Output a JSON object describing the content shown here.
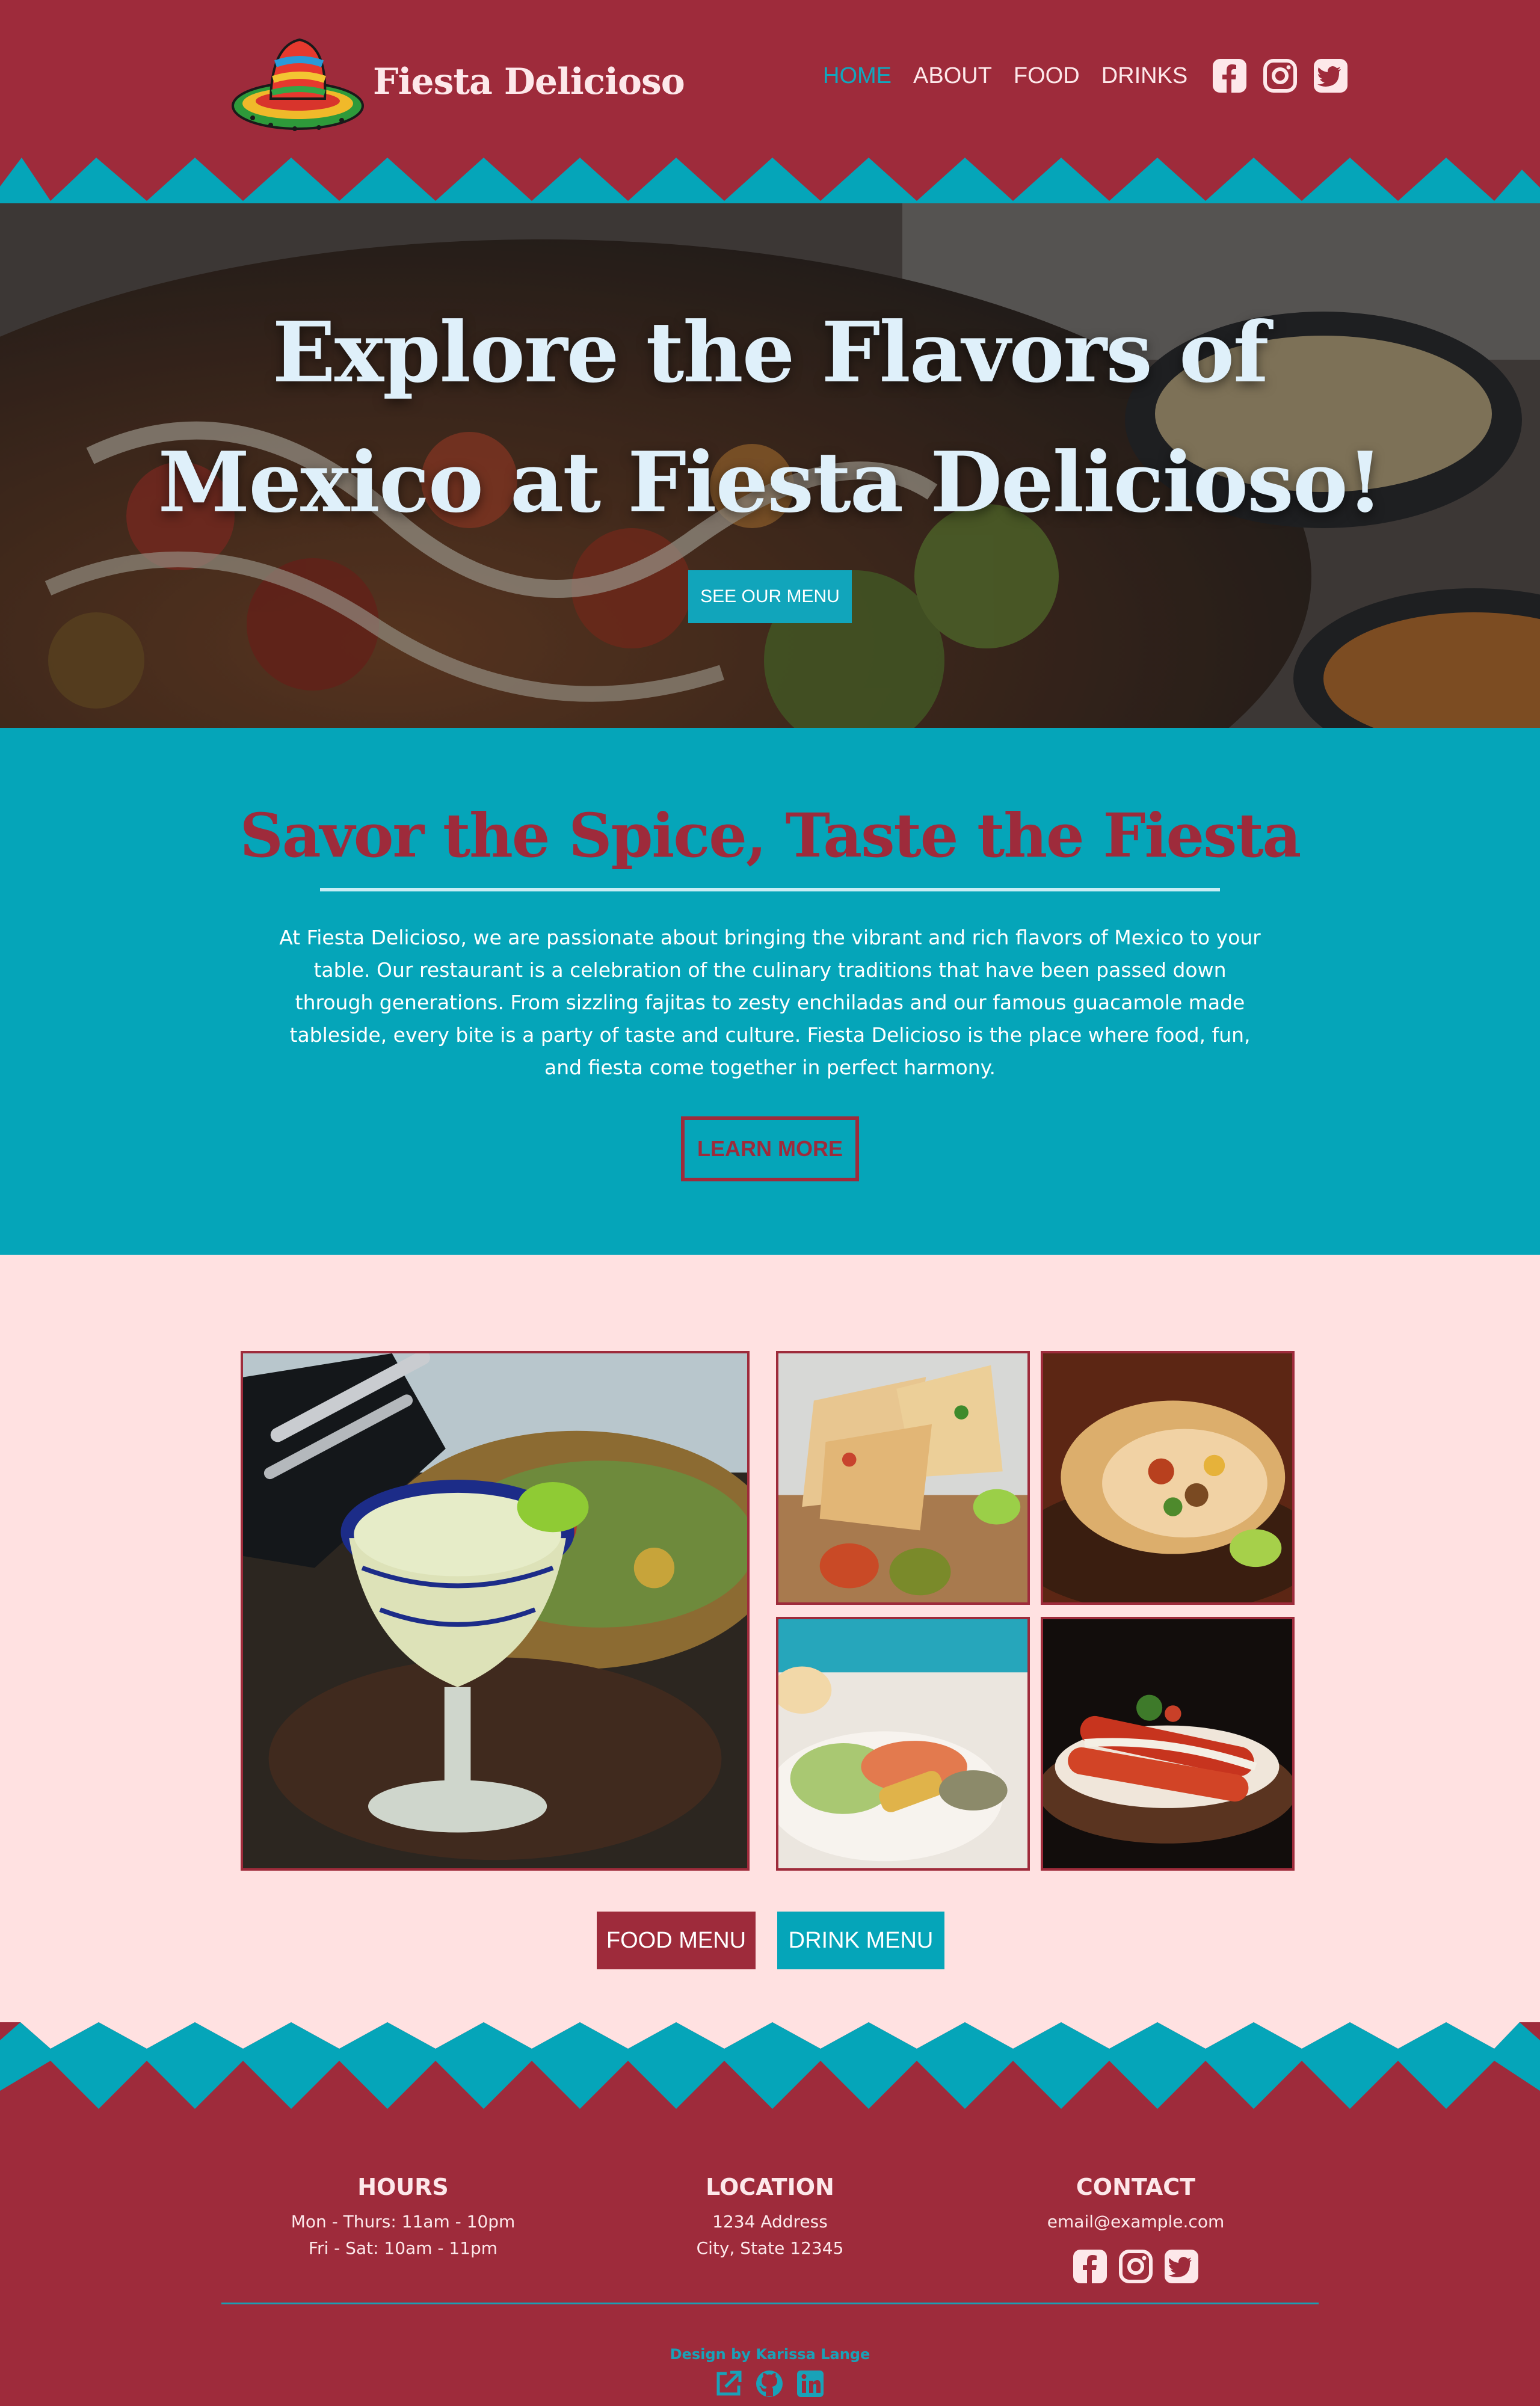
{
  "header": {
    "brand": "Fiesta Delicioso",
    "nav": [
      "HOME",
      "ABOUT",
      "FOOD",
      "DRINKS"
    ],
    "active_nav": "HOME",
    "social_icons": [
      "facebook-icon",
      "instagram-icon",
      "twitter-icon"
    ]
  },
  "hero": {
    "title_line1": "Explore the Flavors of",
    "title_line2": "Mexico at Fiesta Delicioso!",
    "button": "SEE OUR MENU"
  },
  "about": {
    "title": "Savor the Spice, Taste the Fiesta",
    "text": "At Fiesta Delicioso, we are passionate about bringing the vibrant and rich flavors of Mexico to your table. Our restaurant is a celebration of the culinary traditions that have been passed down through generations. From sizzling fajitas to zesty enchiladas and our famous guacamole made tableside, every bite is a party of taste and culture. Fiesta Delicioso is the place where food, fun, and fiesta come together in perfect harmony.",
    "button": "LEARN MORE"
  },
  "gallery": {
    "food_button": "FOOD MENU",
    "drink_button": "DRINK MENU"
  },
  "footer": {
    "hours_title": "HOURS",
    "hours_line1": "Mon - Thurs: 11am - 10pm",
    "hours_line2": "Fri - Sat: 10am - 11pm",
    "location_title": "LOCATION",
    "location_line1": "1234 Address",
    "location_line2": "City, State 12345",
    "contact_title": "CONTACT",
    "contact_email": "email@example.com",
    "credit": "Design by Karissa Lange",
    "credit_icons": [
      "external-link-icon",
      "github-icon",
      "linkedin-icon"
    ]
  },
  "colors": {
    "crimson": "#9e2b3b",
    "teal": "#05a5b9",
    "pink": "#ffe1e1",
    "cream": "#fde8ea"
  }
}
